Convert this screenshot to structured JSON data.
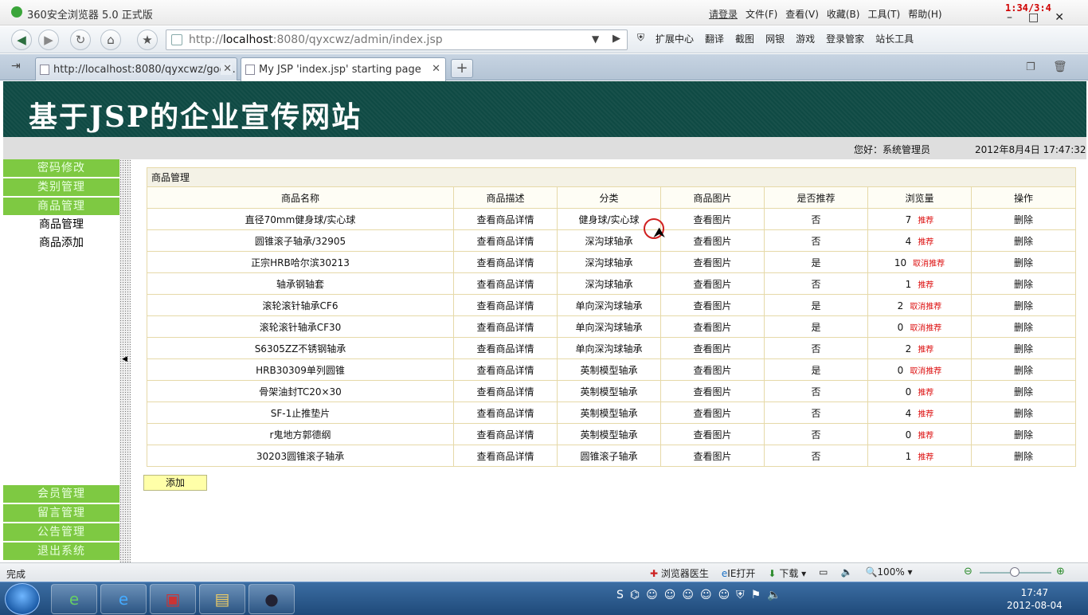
{
  "window": {
    "title": "360安全浏览器 5.0 正式版",
    "login_link": "请登录",
    "menus": [
      "文件(F)",
      "查看(V)",
      "收藏(B)",
      "工具(T)",
      "帮助(H)"
    ],
    "overlay_clock": "1:34/3:4"
  },
  "address_bar": {
    "url_prefix": "http://",
    "url_host": "localhost",
    "url_rest": ":8080/qyxcwz/admin/index.jsp"
  },
  "toolbar": [
    "扩展中心",
    "翻译",
    "截图",
    "网银",
    "游戏",
    "登录管家",
    "站长工具"
  ],
  "tabs": [
    {
      "label": "http://localhost:8080/qyxcwz/goo..."
    },
    {
      "label": "My JSP 'index.jsp' starting page"
    }
  ],
  "site": {
    "title": "基于JSP的企业宣传网站",
    "greeting": "您好：系统管理员",
    "datetime": "2012年8月4日  17:47:32"
  },
  "sidebar": {
    "top_items": [
      "密码修改",
      "类别管理",
      "商品管理"
    ],
    "sub_items": [
      "商品管理",
      "商品添加"
    ],
    "bottom_items": [
      "会员管理",
      "留言管理",
      "公告管理",
      "退出系统"
    ]
  },
  "table": {
    "caption": "商品管理",
    "headers": [
      "商品名称",
      "商品描述",
      "分类",
      "商品图片",
      "是否推荐",
      "浏览量",
      "操作"
    ],
    "rows": [
      {
        "name": "直径70mm健身球/实心球",
        "desc": "查看商品详情",
        "cat": "健身球/实心球",
        "img": "查看图片",
        "rec": "否",
        "views": "7",
        "toggle": "推荐",
        "op": "删除"
      },
      {
        "name": "圆锥滚子轴承/32905",
        "desc": "查看商品详情",
        "cat": "深沟球轴承",
        "img": "查看图片",
        "rec": "否",
        "views": "4",
        "toggle": "推荐",
        "op": "删除"
      },
      {
        "name": "正宗HRB哈尔滨30213",
        "desc": "查看商品详情",
        "cat": "深沟球轴承",
        "img": "查看图片",
        "rec": "是",
        "views": "10",
        "toggle": "取消推荐",
        "op": "删除"
      },
      {
        "name": "轴承钢轴套",
        "desc": "查看商品详情",
        "cat": "深沟球轴承",
        "img": "查看图片",
        "rec": "否",
        "views": "1",
        "toggle": "推荐",
        "op": "删除"
      },
      {
        "name": "滚轮滚针轴承CF6",
        "desc": "查看商品详情",
        "cat": "单向深沟球轴承",
        "img": "查看图片",
        "rec": "是",
        "views": "2",
        "toggle": "取消推荐",
        "op": "删除"
      },
      {
        "name": "滚轮滚针轴承CF30",
        "desc": "查看商品详情",
        "cat": "单向深沟球轴承",
        "img": "查看图片",
        "rec": "是",
        "views": "0",
        "toggle": "取消推荐",
        "op": "删除"
      },
      {
        "name": "S6305ZZ不锈钢轴承",
        "desc": "查看商品详情",
        "cat": "单向深沟球轴承",
        "img": "查看图片",
        "rec": "否",
        "views": "2",
        "toggle": "推荐",
        "op": "删除"
      },
      {
        "name": "HRB30309单列圆锥",
        "desc": "查看商品详情",
        "cat": "英制模型轴承",
        "img": "查看图片",
        "rec": "是",
        "views": "0",
        "toggle": "取消推荐",
        "op": "删除"
      },
      {
        "name": "骨架油封TC20×30",
        "desc": "查看商品详情",
        "cat": "英制模型轴承",
        "img": "查看图片",
        "rec": "否",
        "views": "0",
        "toggle": "推荐",
        "op": "删除"
      },
      {
        "name": "SF-1止推垫片",
        "desc": "查看商品详情",
        "cat": "英制模型轴承",
        "img": "查看图片",
        "rec": "否",
        "views": "4",
        "toggle": "推荐",
        "op": "删除"
      },
      {
        "name": "r鬼地方郭德纲",
        "desc": "查看商品详情",
        "cat": "英制模型轴承",
        "img": "查看图片",
        "rec": "否",
        "views": "0",
        "toggle": "推荐",
        "op": "删除"
      },
      {
        "name": "30203圆锥滚子轴承",
        "desc": "查看商品详情",
        "cat": "圆锥滚子轴承",
        "img": "查看图片",
        "rec": "否",
        "views": "1",
        "toggle": "推荐",
        "op": "删除"
      }
    ],
    "add_label": "添加"
  },
  "statusbar": {
    "status": "完成",
    "items": [
      "浏览器医生",
      "IE打开",
      "下载"
    ],
    "zoom": "100%"
  },
  "taskbar": {
    "time": "17:47",
    "date": "2012-08-04"
  },
  "colors": {
    "banner": "#0f4a44",
    "sidebar_green": "#7ec942",
    "add_button": "#ffffa8",
    "recommend_red": "#dd1111"
  }
}
